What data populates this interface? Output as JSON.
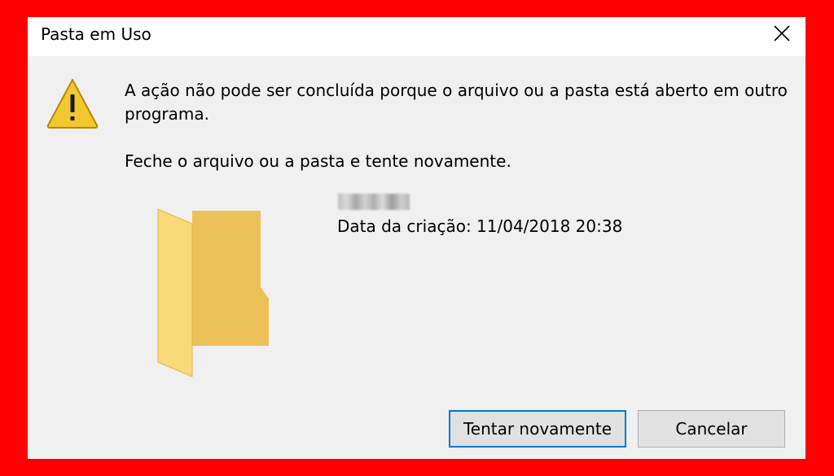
{
  "window": {
    "title": "Pasta em Uso",
    "close_icon": "close-icon"
  },
  "dialog": {
    "icon": "warning-icon",
    "message_main": "A ação não pode ser concluída porque o arquivo ou a pasta está aberto em outro programa.",
    "message_hint": "Feche o arquivo ou a pasta e tente novamente."
  },
  "file": {
    "icon": "folder-icon",
    "name_redacted": true,
    "creation_date": "Data da criação: 11/04/2018 20:38"
  },
  "buttons": {
    "retry_label": "Tentar novamente",
    "cancel_label": "Cancelar"
  },
  "colors": {
    "border": "#ff0000",
    "dialog_bg": "#f0f0f0",
    "titlebar_bg": "#ffffff",
    "default_button_border": "#0078d7",
    "warning_fill": "#f3c82e",
    "folder_fill": "#f8d775"
  }
}
